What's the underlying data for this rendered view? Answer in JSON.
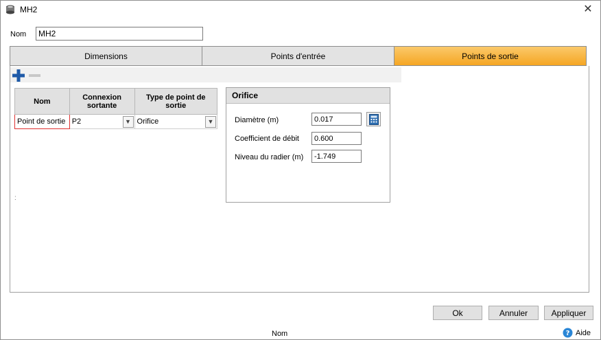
{
  "window": {
    "title": "MH2",
    "close_symbol": "✕"
  },
  "name_field": {
    "label": "Nom",
    "value": "MH2"
  },
  "tabs": [
    {
      "label": "Dimensions",
      "active": false
    },
    {
      "label": "Points d'entrée",
      "active": false
    },
    {
      "label": "Points de sortie",
      "active": true
    }
  ],
  "grid": {
    "headers": [
      "Nom",
      "Connexion sortante",
      "Type de point de sortie"
    ],
    "rows": [
      {
        "name": "Point de sortie",
        "connexion": "P2",
        "type": "Orifice"
      }
    ]
  },
  "stray_mark": ":",
  "orifice_panel": {
    "title": "Orifice",
    "fields": [
      {
        "label": "Diamètre (m)",
        "value": "0.017"
      },
      {
        "label": "Coefficient de débit",
        "value": "0.600"
      },
      {
        "label": "Niveau du radier (m)",
        "value": "-1.749"
      }
    ]
  },
  "buttons": {
    "ok": "Ok",
    "cancel": "Annuler",
    "apply": "Appliquer"
  },
  "status": {
    "text": "Nom",
    "help": "Aide"
  },
  "icons": {
    "app": "manhole-icon",
    "close": "close-icon",
    "add": "plus-icon",
    "remove": "minus-icon",
    "dropdown": "chevron-down-icon",
    "calculator": "calculator-icon",
    "help": "help-icon"
  },
  "colors": {
    "active_tab": "#f5a623",
    "add_icon": "#1e5aa8",
    "highlight_border": "#e03030",
    "help_icon": "#2a86d6"
  }
}
